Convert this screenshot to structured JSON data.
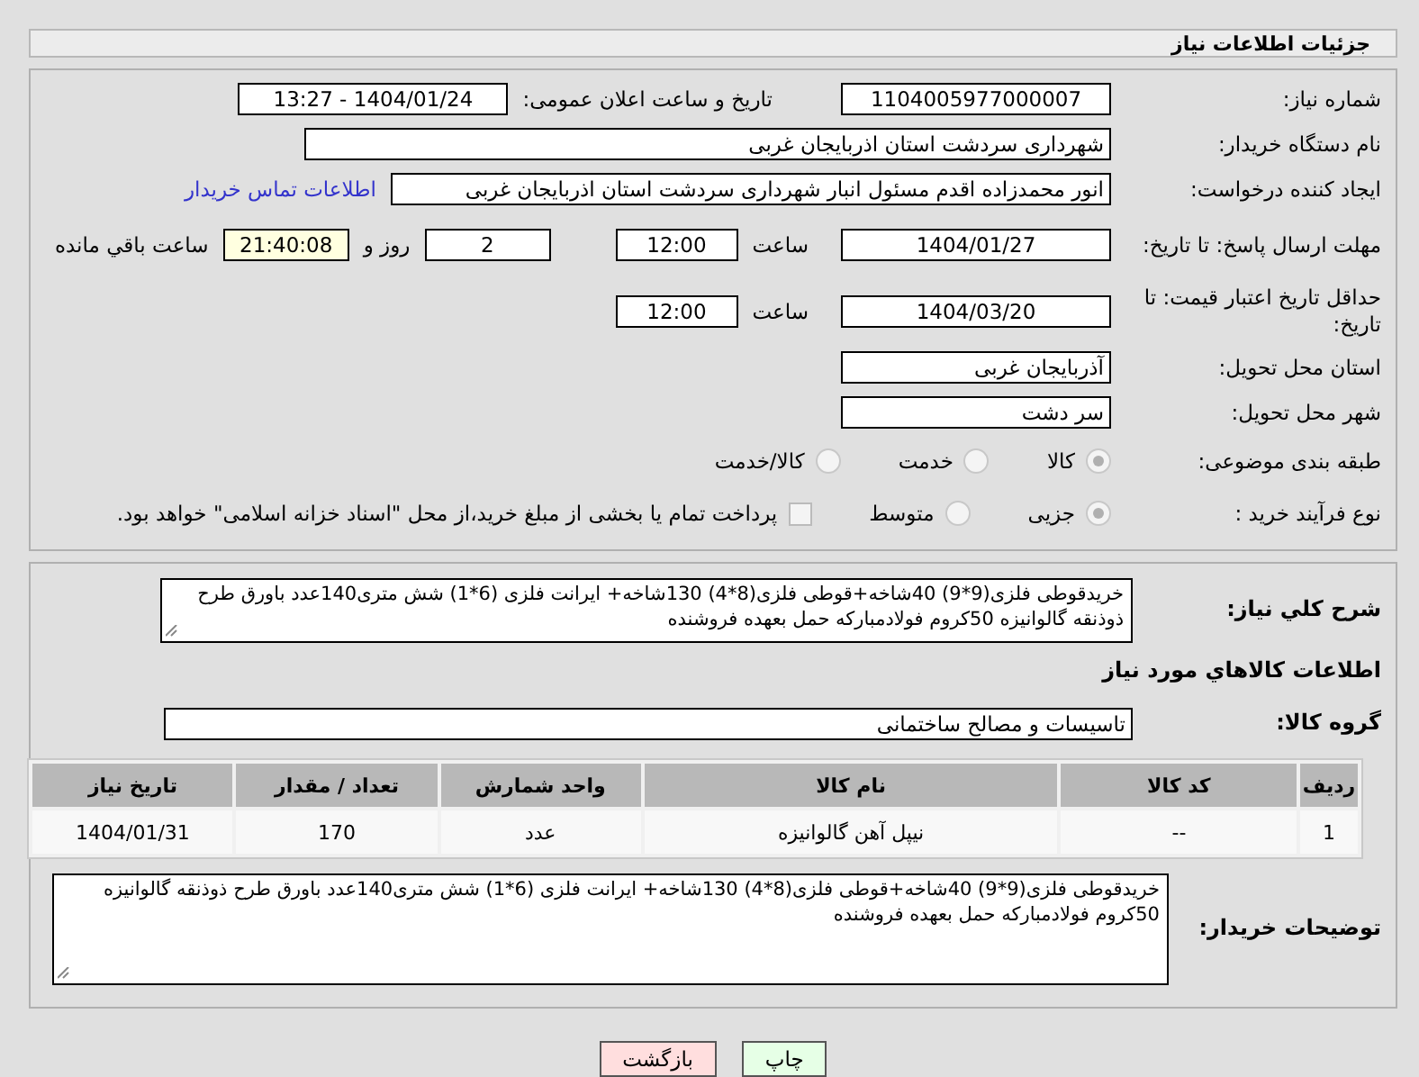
{
  "header": {
    "title": "جزئیات اطلاعات نیاز"
  },
  "fields": {
    "need_number": {
      "label": "شماره نیاز:",
      "value": "1104005977000007"
    },
    "announce": {
      "label": "تاریخ و ساعت اعلان عمومی:",
      "value": "1404/01/24 - 13:27"
    },
    "buyer": {
      "label": "نام دستگاه خریدار:",
      "value": "شهرداری سردشت استان اذربایجان غربی"
    },
    "creator": {
      "label": "ایجاد کننده درخواست:",
      "value": "انور محمدزاده اقدم مسئول انبار شهرداری سردشت استان اذربایجان غربی",
      "link": "اطلاعات تماس خریدار"
    },
    "deadline": {
      "label": "مهلت ارسال پاسخ: تا تاریخ:",
      "date": "1404/01/27",
      "time_label": "ساعت",
      "time": "12:00",
      "days": "2",
      "days_label": "روز و",
      "remaining": "21:40:08",
      "remaining_label": "ساعت باقي مانده"
    },
    "validity": {
      "label": "حداقل تاریخ اعتبار قیمت: تا تاریخ:",
      "date": "1404/03/20",
      "time_label": "ساعت",
      "time": "12:00"
    },
    "province": {
      "label": "استان محل تحویل:",
      "value": "آذربایجان غربی"
    },
    "city": {
      "label": "شهر محل تحویل:",
      "value": "سر دشت"
    }
  },
  "category": {
    "label": "طبقه بندی موضوعی:",
    "options": [
      {
        "label": "کالا",
        "selected": true
      },
      {
        "label": "خدمت",
        "selected": false
      },
      {
        "label": "کالا/خدمت",
        "selected": false
      }
    ]
  },
  "process": {
    "label": "نوع فرآیند خرید :",
    "options": [
      {
        "label": "جزیی",
        "selected": true
      },
      {
        "label": "متوسط",
        "selected": false
      }
    ],
    "treasury": {
      "checked": false,
      "text": "پرداخت تمام یا بخشی از مبلغ خرید،از محل \"اسناد خزانه اسلامی\" خواهد بود."
    }
  },
  "description": {
    "label": "شرح کلي نیاز:",
    "value": "خریدقوطی فلزی(9*9) 40شاخه+قوطی فلزی(8*4) 130شاخه+ ایرانت فلزی (6*1) شش متری140عدد باورق طرح ذوذنقه گالوانیزه 50کروم فولادمبارکه حمل بعهده فروشنده"
  },
  "goods_heading": "اطلاعات کالاهاي مورد نیاز",
  "goods_group": {
    "label": "گروه کالا:",
    "value": "تاسیسات و مصالح ساختمانی"
  },
  "table": {
    "columns": [
      "ردیف",
      "کد کالا",
      "نام کالا",
      "واحد شمارش",
      "تعداد / مقدار",
      "تاریخ نیاز"
    ],
    "rows": [
      [
        "1",
        "--",
        "نیپل آهن گالوانیزه",
        "عدد",
        "170",
        "1404/01/31"
      ]
    ]
  },
  "buyer_notes": {
    "label": "توضیحات خریدار:",
    "value": "خریدقوطی فلزی(9*9) 40شاخه+قوطی فلزی(8*4) 130شاخه+ ایرانت فلزی (6*1) شش متری140عدد باورق طرح ذوذنقه گالوانیزه 50کروم فولادمبارکه حمل بعهده فروشنده"
  },
  "buttons": [
    {
      "label": "چاپ",
      "kind": "print"
    },
    {
      "label": "بازگشت",
      "kind": "back"
    }
  ]
}
